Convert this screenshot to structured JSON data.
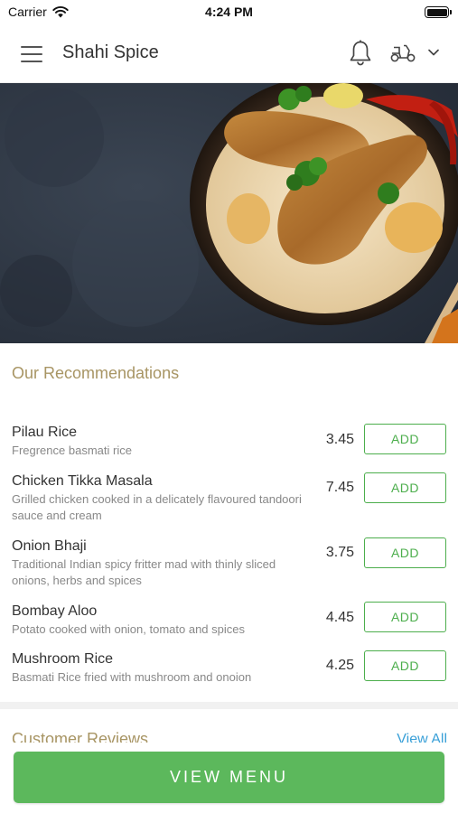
{
  "status_bar": {
    "carrier": "Carrier",
    "time": "4:24 PM",
    "icons": [
      "wifi-icon",
      "battery-icon"
    ]
  },
  "header": {
    "title": "Shahi Spice",
    "icons": [
      "menu-icon",
      "bell-icon",
      "scooter-icon",
      "chevron-down-icon"
    ]
  },
  "hero": {
    "image": "food-photo"
  },
  "recommendations": {
    "title": "Our Recommendations",
    "items": [
      {
        "name": "Pilau Rice",
        "description": "Fregrence basmati rice",
        "price": "3.45",
        "add_label": "ADD"
      },
      {
        "name": "Chicken Tikka Masala",
        "description": "Grilled chicken cooked in a delicately flavoured tandoori sauce and cream",
        "price": "7.45",
        "add_label": "ADD"
      },
      {
        "name": "Onion Bhaji",
        "description": "Traditional Indian spicy fritter mad with thinly sliced onions, herbs and spices",
        "price": "3.75",
        "add_label": "ADD"
      },
      {
        "name": "Bombay Aloo",
        "description": "Potato cooked with onion, tomato and spices",
        "price": "4.45",
        "add_label": "ADD"
      },
      {
        "name": "Mushroom Rice",
        "description": "Basmati Rice fried with mushroom and onoion",
        "price": "4.25",
        "add_label": "ADD"
      }
    ]
  },
  "reviews": {
    "title": "Customer Reviews",
    "view_all": "View All"
  },
  "footer": {
    "view_menu": "VIEW MENU"
  },
  "colors": {
    "accent_green": "#5cb85c",
    "section_title": "#a89564",
    "link_blue": "#3aa0d8"
  }
}
